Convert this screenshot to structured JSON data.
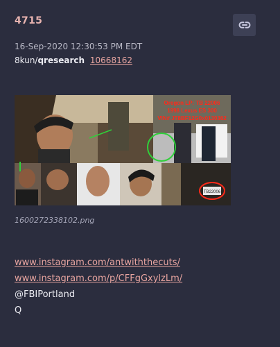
{
  "post": {
    "number": "4715",
    "timestamp": "16-Sep-2020 12:30:53 PM EDT",
    "source_prefix": "8kun/",
    "source_board": "qresearch",
    "source_ref": "10668162",
    "image": {
      "filename": "1600272338102.png",
      "overlay_lines": [
        "Oregon LP: TB 22006",
        "1998 Lexus ES 300",
        "VIN# JT8BF12G0x0130362"
      ],
      "plate_text": "TB22006"
    },
    "lines": [
      {
        "text": "www.instagram.com/antwiththecuts/",
        "type": "link"
      },
      {
        "text": "www.instagram.com/p/CFFgGxylzLm/",
        "type": "link"
      },
      {
        "text": "@FBIPortland",
        "type": "text"
      },
      {
        "text": "Q",
        "type": "text"
      }
    ]
  },
  "icons": {
    "link": "link-chain-icon"
  },
  "colors": {
    "background": "#2b2d3e",
    "accent": "#e8b4b0",
    "link": "#e8a5a0",
    "button": "#3d4055"
  }
}
